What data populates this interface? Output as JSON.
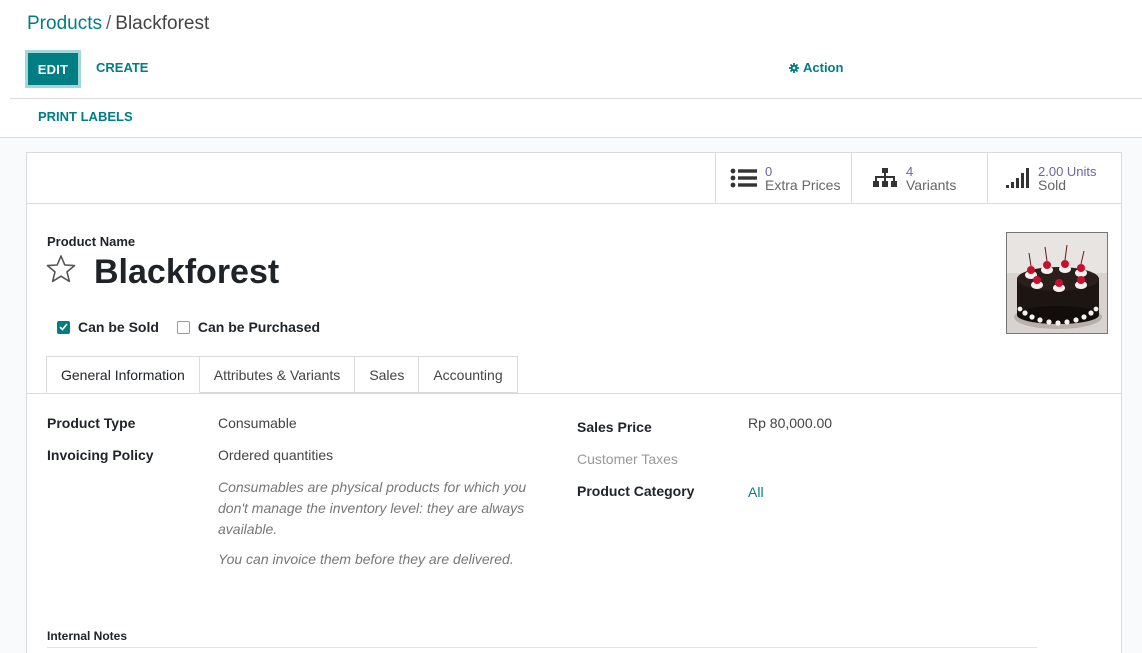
{
  "breadcrumb": {
    "parent": "Products",
    "separator": "/",
    "current": "Blackforest"
  },
  "toolbar": {
    "edit_label": "EDIT",
    "create_label": "CREATE",
    "action_label": "Action",
    "print_labels": "PRINT LABELS"
  },
  "stat_buttons": [
    {
      "value": "0",
      "label": "Extra Prices",
      "icon": "list-icon"
    },
    {
      "value": "4",
      "label": "Variants",
      "icon": "sitemap-icon"
    },
    {
      "value": "2.00 Units",
      "label": "Sold",
      "icon": "signal-bars-icon"
    }
  ],
  "product": {
    "name_label": "Product Name",
    "name": "Blackforest",
    "favorite": false,
    "can_be_sold_label": "Can be Sold",
    "can_be_sold": true,
    "can_be_purchased_label": "Can be Purchased",
    "can_be_purchased": false
  },
  "tabs": [
    "General Information",
    "Attributes & Variants",
    "Sales",
    "Accounting"
  ],
  "general": {
    "product_type_label": "Product Type",
    "product_type": "Consumable",
    "invoicing_policy_label": "Invoicing Policy",
    "invoicing_policy": "Ordered quantities",
    "help_consumable": "Consumables are physical products for which you don't manage the inventory level: they are always available.",
    "help_invoice": "You can invoice them before they are delivered.",
    "sales_price_label": "Sales Price",
    "sales_price": "Rp 80,000.00",
    "customer_taxes_label": "Customer Taxes",
    "product_category_label": "Product Category",
    "product_category": "All",
    "internal_notes_label": "Internal Notes"
  },
  "colors": {
    "accent": "#017e84",
    "stat_value": "#71639e"
  }
}
